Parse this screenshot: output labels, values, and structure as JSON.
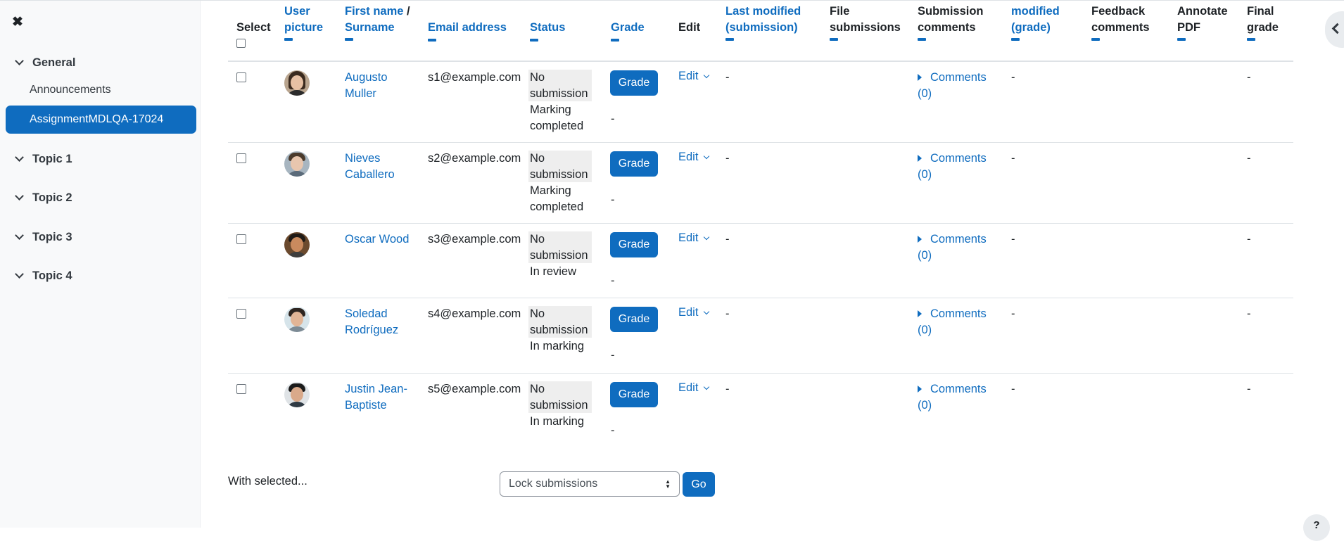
{
  "drawer": {
    "close_glyph": "✖",
    "sections": [
      {
        "label": "General"
      },
      {
        "label": "Topic 1"
      },
      {
        "label": "Topic 2"
      },
      {
        "label": "Topic 3"
      },
      {
        "label": "Topic 4"
      }
    ],
    "links": [
      {
        "label": "Announcements"
      },
      {
        "label": "AssignmentMDLQA-17024",
        "active": true
      }
    ]
  },
  "table": {
    "headers": {
      "select": "Select",
      "user_picture_1": "User",
      "user_picture_2": "picture",
      "firstname": "First name",
      "sep": "/",
      "surname": "Surname",
      "email": "Email address",
      "status": "Status",
      "grade": "Grade",
      "edit": "Edit",
      "last_modified_1": "Last modified",
      "last_modified_2": "(submission)",
      "file_submissions_1": "File",
      "file_submissions_2": "submissions",
      "submission_comments_1": "Submission",
      "submission_comments_2": "comments",
      "modified_grade_1": "modified",
      "modified_grade_2": "(grade)",
      "feedback_comments_1": "Feedback",
      "feedback_comments_2": "comments",
      "annotate_pdf_1": "Annotate",
      "annotate_pdf_2": "PDF",
      "final_grade_1": "Final",
      "final_grade_2": "grade"
    },
    "rows": [
      {
        "name_1": "Augusto",
        "name_2": "Muller",
        "email": "s1@example.com",
        "status_1": "No",
        "status_2": "submission",
        "grading_1": "Marking",
        "grading_2": "completed",
        "grade_button": "Grade",
        "grade_value": "-",
        "edit": "Edit",
        "last_modified": "-",
        "comments_1": "Comments",
        "comments_2": "(0)",
        "modified_grade": "-",
        "final_grade": "-"
      },
      {
        "name_1": "Nieves",
        "name_2": "Caballero",
        "email": "s2@example.com",
        "status_1": "No",
        "status_2": "submission",
        "grading_1": "Marking",
        "grading_2": "completed",
        "grade_button": "Grade",
        "grade_value": "-",
        "edit": "Edit",
        "last_modified": "-",
        "comments_1": "Comments",
        "comments_2": "(0)",
        "modified_grade": "-",
        "final_grade": "-"
      },
      {
        "name_1": "Oscar Wood",
        "name_2": "",
        "email": "s3@example.com",
        "status_1": "No",
        "status_2": "submission",
        "grading_1": "In review",
        "grading_2": "",
        "grade_button": "Grade",
        "grade_value": "-",
        "edit": "Edit",
        "last_modified": "-",
        "comments_1": "Comments",
        "comments_2": "(0)",
        "modified_grade": "-",
        "final_grade": "-"
      },
      {
        "name_1": "Soledad",
        "name_2": "Rodríguez",
        "email": "s4@example.com",
        "status_1": "No",
        "status_2": "submission",
        "grading_1": "In marking",
        "grading_2": "",
        "grade_button": "Grade",
        "grade_value": "-",
        "edit": "Edit",
        "last_modified": "-",
        "comments_1": "Comments",
        "comments_2": "(0)",
        "modified_grade": "-",
        "final_grade": "-"
      },
      {
        "name_1": "Justin Jean-",
        "name_2": "Baptiste",
        "email": "s5@example.com",
        "status_1": "No",
        "status_2": "submission",
        "grading_1": "In marking",
        "grading_2": "",
        "grade_button": "Grade",
        "grade_value": "-",
        "edit": "Edit",
        "last_modified": "-",
        "comments_1": "Comments",
        "comments_2": "(0)",
        "modified_grade": "-",
        "final_grade": "-"
      }
    ]
  },
  "footer": {
    "with_selected": "With selected...",
    "bulk_action": "Lock submissions",
    "go_label": "Go"
  },
  "help": {
    "label": "?"
  },
  "colors": {
    "primary": "#0f6cbf",
    "drawer_bg": "#f8f9fa",
    "status_bg": "#eeeeee"
  }
}
